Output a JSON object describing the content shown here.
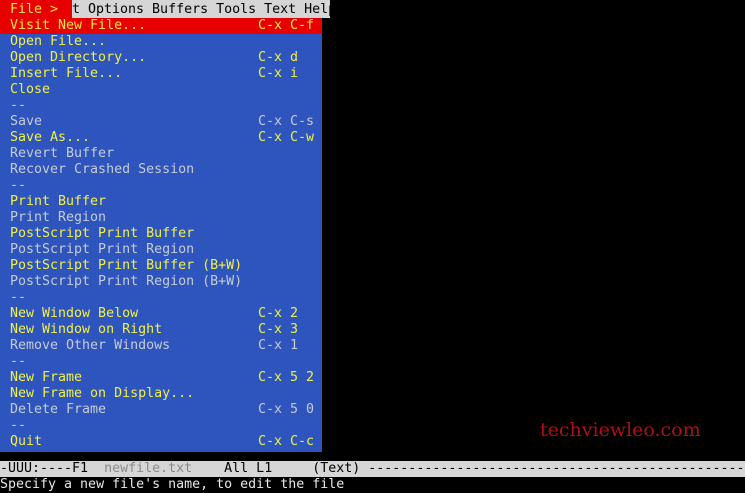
{
  "menubar": {
    "file": "File >",
    "rest": "t Options Buffers Tools Text Help"
  },
  "menu": {
    "items": [
      {
        "label": "Visit New File...",
        "shortcut": "C-x C-f",
        "state": "sel"
      },
      {
        "label": "Open File...",
        "shortcut": "",
        "state": "on"
      },
      {
        "label": "Open Directory...",
        "shortcut": "C-x d",
        "state": "on"
      },
      {
        "label": "Insert File...",
        "shortcut": "C-x i",
        "state": "on"
      },
      {
        "label": "Close",
        "shortcut": "",
        "state": "on"
      },
      {
        "label": "--",
        "shortcut": "",
        "state": "off"
      },
      {
        "label": "Save",
        "shortcut": "C-x C-s",
        "state": "off"
      },
      {
        "label": "Save As...",
        "shortcut": "C-x C-w",
        "state": "on"
      },
      {
        "label": "Revert Buffer",
        "shortcut": "",
        "state": "off"
      },
      {
        "label": "Recover Crashed Session",
        "shortcut": "",
        "state": "off"
      },
      {
        "label": "--",
        "shortcut": "",
        "state": "off"
      },
      {
        "label": "Print Buffer",
        "shortcut": "",
        "state": "on"
      },
      {
        "label": "Print Region",
        "shortcut": "",
        "state": "off"
      },
      {
        "label": "PostScript Print Buffer",
        "shortcut": "",
        "state": "on"
      },
      {
        "label": "PostScript Print Region",
        "shortcut": "",
        "state": "off"
      },
      {
        "label": "PostScript Print Buffer (B+W)",
        "shortcut": "",
        "state": "on"
      },
      {
        "label": "PostScript Print Region (B+W)",
        "shortcut": "",
        "state": "off"
      },
      {
        "label": "--",
        "shortcut": "",
        "state": "off"
      },
      {
        "label": "New Window Below",
        "shortcut": "C-x 2",
        "state": "on"
      },
      {
        "label": "New Window on Right",
        "shortcut": "C-x 3",
        "state": "on"
      },
      {
        "label": "Remove Other Windows",
        "shortcut": "C-x 1",
        "state": "off"
      },
      {
        "label": "--",
        "shortcut": "",
        "state": "off"
      },
      {
        "label": "New Frame",
        "shortcut": "C-x 5 2",
        "state": "on"
      },
      {
        "label": "New Frame on Display...",
        "shortcut": "",
        "state": "on"
      },
      {
        "label": "Delete Frame",
        "shortcut": "C-x 5 0",
        "state": "off"
      },
      {
        "label": "--",
        "shortcut": "",
        "state": "off"
      },
      {
        "label": "Quit",
        "shortcut": "C-x C-c",
        "state": "on"
      }
    ]
  },
  "modeline": {
    "prefix": "-UUU:----F1  ",
    "filename": "newfile.txt",
    "position": "    All L1     ",
    "mode": "(Text) ",
    "fill": "------------------------------------------------------------"
  },
  "echo": "Specify a new file's name, to edit the file",
  "watermark": "techviewleo.com"
}
